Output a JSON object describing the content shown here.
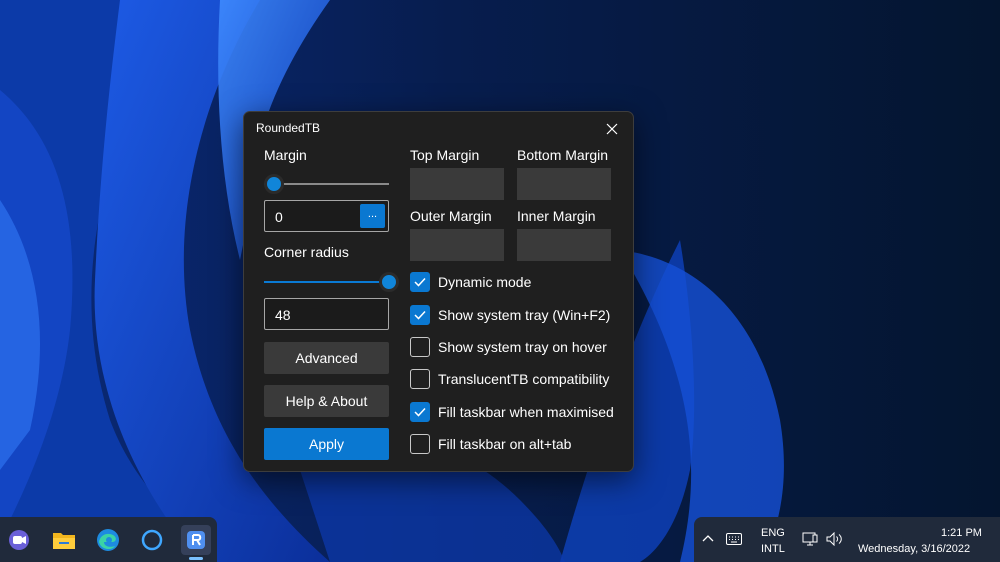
{
  "window": {
    "title": "RoundedTB"
  },
  "left_panel": {
    "margin_label": "Margin",
    "margin_value": "0",
    "margin_slider_fraction": 0.0,
    "more_button_label": "...",
    "corner_radius_label": "Corner radius",
    "corner_radius_value": "48",
    "corner_radius_slider_fraction": 1.0,
    "advanced_label": "Advanced",
    "help_about_label": "Help & About",
    "apply_label": "Apply"
  },
  "right_panel": {
    "top_margin_label": "Top Margin",
    "bottom_margin_label": "Bottom Margin",
    "outer_margin_label": "Outer Margin",
    "inner_margin_label": "Inner Margin",
    "options": [
      {
        "label": "Dynamic mode",
        "checked": true
      },
      {
        "label": "Show system tray (Win+F2)",
        "checked": true
      },
      {
        "label": "Show system tray on hover",
        "checked": false
      },
      {
        "label": "TranslucentTB compatibility",
        "checked": false
      },
      {
        "label": "Fill taskbar when maximised",
        "checked": true
      },
      {
        "label": "Fill taskbar on alt+tab",
        "checked": false
      }
    ]
  },
  "taskbar": {
    "apps": [
      {
        "icon": "teams-chat-icon"
      },
      {
        "icon": "file-explorer-icon"
      },
      {
        "icon": "edge-icon"
      },
      {
        "icon": "cortana-icon"
      },
      {
        "icon": "roundedtb-icon",
        "active": true
      }
    ],
    "tray": {
      "language_line1": "ENG",
      "language_line2": "INTL",
      "time": "1:21 PM",
      "date": "Wednesday, 3/16/2022"
    }
  },
  "colors": {
    "accent": "#0a78d1",
    "window_bg": "#1f1f1f",
    "button_bg": "#3a3a3a",
    "taskbar_bg": "#202a3b"
  }
}
